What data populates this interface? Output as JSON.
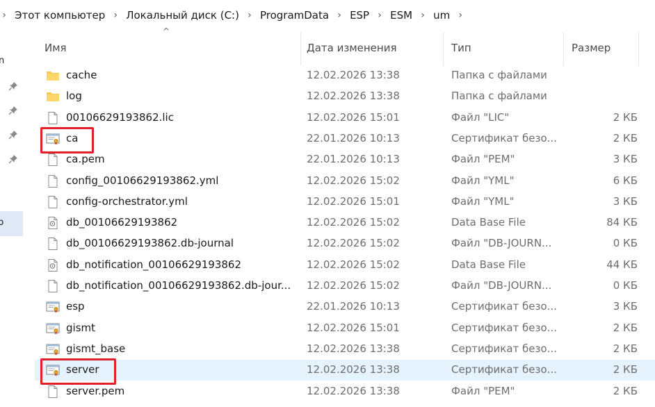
{
  "address": {
    "crumbs": [
      "Этот компьютер",
      "Локальный диск (C:)",
      "ProgramData",
      "ESP",
      "ESM",
      "um"
    ]
  },
  "nav": {
    "partial_labels": [
      "n",
      "p"
    ]
  },
  "columns": {
    "name": "Имя",
    "date": "Дата изменения",
    "type": "Тип",
    "size": "Размер",
    "sort_column": "name"
  },
  "files": [
    {
      "name": "cache",
      "icon": "folder-icon",
      "date": "12.02.2026 13:38",
      "type": "Папка с файлами",
      "size": ""
    },
    {
      "name": "log",
      "icon": "folder-icon",
      "date": "12.02.2026 13:38",
      "type": "Папка с файлами",
      "size": ""
    },
    {
      "name": "00106629193862.lic",
      "icon": "file-icon",
      "date": "12.02.2026 15:01",
      "type": "Файл \"LIC\"",
      "size": "2 КБ"
    },
    {
      "name": "ca",
      "icon": "certificate-icon",
      "date": "22.01.2026 10:13",
      "type": "Сертификат безо...",
      "size": "2 КБ",
      "marked": true
    },
    {
      "name": "ca.pem",
      "icon": "file-icon",
      "date": "22.01.2026 10:13",
      "type": "Файл \"PEM\"",
      "size": "3 КБ"
    },
    {
      "name": "config_00106629193862.yml",
      "icon": "file-icon",
      "date": "12.02.2026 15:02",
      "type": "Файл \"YML\"",
      "size": "6 КБ"
    },
    {
      "name": "config-orchestrator.yml",
      "icon": "file-icon",
      "date": "12.02.2026 15:01",
      "type": "Файл \"YML\"",
      "size": "3 КБ"
    },
    {
      "name": "db_00106629193862",
      "icon": "database-file-icon",
      "date": "12.02.2026 15:02",
      "type": "Data Base File",
      "size": "84 КБ"
    },
    {
      "name": "db_00106629193862.db-journal",
      "icon": "file-icon",
      "date": "12.02.2026 15:02",
      "type": "Файл \"DB-JOURN...",
      "size": "0 КБ"
    },
    {
      "name": "db_notification_00106629193862",
      "icon": "database-file-icon",
      "date": "12.02.2026 15:02",
      "type": "Data Base File",
      "size": "44 КБ"
    },
    {
      "name": "db_notification_00106629193862.db-jour...",
      "icon": "file-icon",
      "date": "12.02.2026 15:02",
      "type": "Файл \"DB-JOURN...",
      "size": "0 КБ"
    },
    {
      "name": "esp",
      "icon": "certificate-icon",
      "date": "22.01.2026 10:13",
      "type": "Сертификат безо...",
      "size": "3 КБ"
    },
    {
      "name": "gismt",
      "icon": "certificate-icon",
      "date": "12.02.2026 15:01",
      "type": "Сертификат безо...",
      "size": "2 КБ"
    },
    {
      "name": "gismt_base",
      "icon": "certificate-icon",
      "date": "12.02.2026 13:38",
      "type": "Сертификат безо...",
      "size": "2 КБ"
    },
    {
      "name": "server",
      "icon": "certificate-icon",
      "date": "12.02.2026 13:38",
      "type": "Сертификат безо...",
      "size": "2 КБ",
      "marked": true,
      "hovered": true
    },
    {
      "name": "server.pem",
      "icon": "file-icon",
      "date": "12.02.2026 13:38",
      "type": "Файл \"PEM\"",
      "size": "2 КБ"
    }
  ],
  "colors": {
    "highlight": "#e5f3ff",
    "marker": "#e0202a",
    "folder": "#f8c94e"
  }
}
